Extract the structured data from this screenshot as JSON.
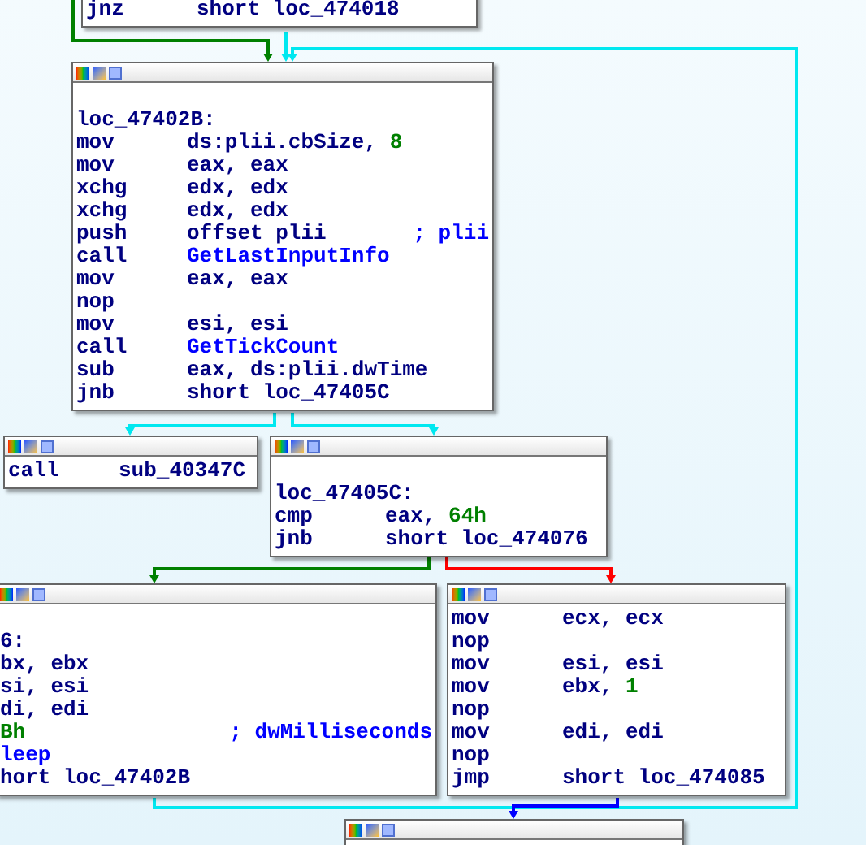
{
  "nodes": [
    {
      "lines": [
        {
          "mnemonic": "jnz",
          "operands": [
            {
              "text": "short loc_474018",
              "kind": "reg"
            }
          ]
        }
      ]
    },
    {
      "lines": [
        {
          "kind": "label",
          "operands": [
            {
              "text": "loc_47402B:",
              "kind": "reg"
            }
          ]
        },
        {
          "mnemonic": "mov",
          "operands": [
            {
              "text": "ds:plii.cbSize, ",
              "kind": "reg"
            },
            {
              "text": "8",
              "kind": "number"
            }
          ]
        },
        {
          "mnemonic": "mov",
          "operands": [
            {
              "text": "eax, eax",
              "kind": "reg"
            }
          ]
        },
        {
          "mnemonic": "xchg",
          "operands": [
            {
              "text": "edx, edx",
              "kind": "reg"
            }
          ]
        },
        {
          "mnemonic": "xchg",
          "operands": [
            {
              "text": "edx, edx",
              "kind": "reg"
            }
          ]
        },
        {
          "mnemonic": "push",
          "operands": [
            {
              "text": "offset plii",
              "kind": "reg"
            }
          ],
          "comment": "; plii"
        },
        {
          "mnemonic": "call",
          "operands": [
            {
              "text": "GetLastInputInfo",
              "kind": "name"
            }
          ]
        },
        {
          "mnemonic": "mov",
          "operands": [
            {
              "text": "eax, eax",
              "kind": "reg"
            }
          ]
        },
        {
          "mnemonic": "nop"
        },
        {
          "mnemonic": "mov",
          "operands": [
            {
              "text": "esi, esi",
              "kind": "reg"
            }
          ]
        },
        {
          "mnemonic": "call",
          "operands": [
            {
              "text": "GetTickCount",
              "kind": "name"
            }
          ]
        },
        {
          "mnemonic": "sub",
          "operands": [
            {
              "text": "eax, ds:plii.dwTime",
              "kind": "reg"
            }
          ]
        },
        {
          "mnemonic": "jnb",
          "operands": [
            {
              "text": "short loc_47405C",
              "kind": "reg"
            }
          ]
        }
      ]
    },
    {
      "lines": [
        {
          "mnemonic": "call",
          "operands": [
            {
              "text": "sub_40347C",
              "kind": "reg"
            }
          ]
        }
      ]
    },
    {
      "lines": [
        {
          "kind": "label",
          "operands": [
            {
              "text": "loc_47405C:",
              "kind": "reg"
            }
          ]
        },
        {
          "mnemonic": "cmp",
          "operands": [
            {
              "text": "eax, ",
              "kind": "reg"
            },
            {
              "text": "64h",
              "kind": "number"
            }
          ]
        },
        {
          "mnemonic": "jnb",
          "operands": [
            {
              "text": "short loc_474076",
              "kind": "reg"
            }
          ]
        }
      ]
    },
    {
      "lines": [
        {
          "kind": "label",
          "operands": [
            {
              "text": "6:",
              "kind": "reg"
            }
          ]
        },
        {
          "operands": [
            {
              "text": "bx, ebx",
              "kind": "reg"
            }
          ]
        },
        {
          "operands": [
            {
              "text": "si, esi",
              "kind": "reg"
            }
          ]
        },
        {
          "operands": [
            {
              "text": "di, edi",
              "kind": "reg"
            }
          ]
        },
        {
          "operands": [
            {
              "text": "Bh",
              "kind": "number"
            }
          ],
          "comment": "; dwMilliseconds"
        },
        {
          "operands": [
            {
              "text": "leep",
              "kind": "name"
            }
          ]
        },
        {
          "operands": [
            {
              "text": "hort loc_47402B",
              "kind": "reg"
            }
          ]
        }
      ]
    },
    {
      "lines": [
        {
          "mnemonic": "mov",
          "operands": [
            {
              "text": "ecx, ecx",
              "kind": "reg"
            }
          ]
        },
        {
          "mnemonic": "nop"
        },
        {
          "mnemonic": "mov",
          "operands": [
            {
              "text": "esi, esi",
              "kind": "reg"
            }
          ]
        },
        {
          "mnemonic": "mov",
          "operands": [
            {
              "text": "ebx, ",
              "kind": "reg"
            },
            {
              "text": "1",
              "kind": "number"
            }
          ]
        },
        {
          "mnemonic": "nop"
        },
        {
          "mnemonic": "mov",
          "operands": [
            {
              "text": "edi, edi",
              "kind": "reg"
            }
          ]
        },
        {
          "mnemonic": "nop"
        },
        {
          "mnemonic": "jmp",
          "operands": [
            {
              "text": "short loc_474085",
              "kind": "reg"
            }
          ]
        }
      ]
    }
  ]
}
